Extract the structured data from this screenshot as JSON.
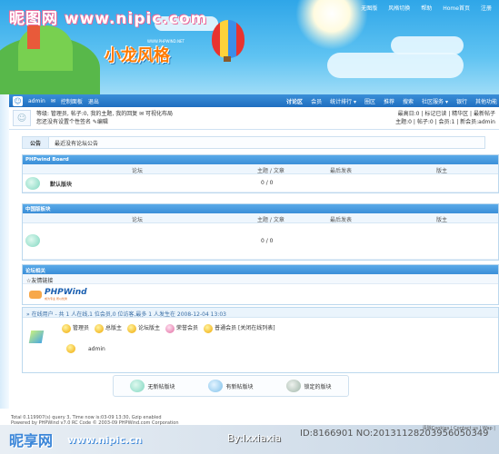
{
  "watermark": {
    "top": "昵图网 www.nipic.com",
    "bottom_brand": "昵享网",
    "bottom_url": "www.nipic.cn",
    "bottom_by": "By:lxxiaxia",
    "bottom_id": "ID:8166901 NO:20131128203956050349"
  },
  "logo": {
    "title": "小龙风格",
    "sub": "WWW.PHPWIND.NET"
  },
  "toplinks": [
    "无图版",
    "风格切换",
    "帮助",
    "Home首页",
    "注册"
  ],
  "userbar": {
    "user": "admin",
    "items": [
      "控制面板",
      "退出"
    ],
    "nav": [
      "讨论区",
      "会员",
      "统计排行 ▾",
      "圈区",
      "推荐",
      "搜索",
      "社区服务 ▾",
      "银行",
      "其他功能"
    ]
  },
  "info": {
    "line1": "等级: 管理员, 帖子:0, 我的主题, 我的回复 ✉ 可视化布局",
    "line2": "您还没有设置个性签名 ✎编辑",
    "right1": "最高日:0 | 标记已读 | 精华区 | 最新帖子",
    "right2": "主题:0 | 帖子:0 | 会员:1 | 新会员:admin"
  },
  "notice": {
    "label": "公告",
    "text": "最近没有论坛公告"
  },
  "sections": [
    {
      "title": "PHPwind Board",
      "col_forum": "论坛",
      "col_topics": "主题 / 文章",
      "col_last": "最后发表",
      "col_mod": "版主",
      "forum": "默认版块",
      "count": "0 / 0"
    },
    {
      "title": "中国版板块",
      "col_forum": "论坛",
      "col_topics": "主题 / 文章",
      "col_last": "最后发表",
      "col_mod": "版主",
      "forum": "",
      "count": "0 / 0"
    }
  ],
  "friend": {
    "title": "论坛相关",
    "sub": "☆友情链接",
    "logo": "PHPWind",
    "tag": "成为专业 所以优秀"
  },
  "online": {
    "bar": "» 在线用户 - 共 1 人在线,1 位会员,0 位访客,最多 1 人发生在 2008-12-04 13:03",
    "legend": [
      "管理员",
      "总版主",
      "论坛版主",
      "荣誉会员",
      "普通会员 [关闭在线列表]"
    ],
    "user": "admin"
  },
  "buttons": [
    "无新帖版块",
    "有新帖版块",
    "锁定的版块"
  ],
  "footer": {
    "l1": "Total 0.119907(s) query 3, Time now is:03-09 13:30, Gzip enabled",
    "l2": "Powered by PHPWind v7.0 RC Code © 2003-09 PHPWind.com Corporation",
    "right": "清除Cookies | Contact us | Wap |"
  },
  "colors": {
    "accent": "#3a8ed8",
    "banner": "#4bb8ef"
  }
}
